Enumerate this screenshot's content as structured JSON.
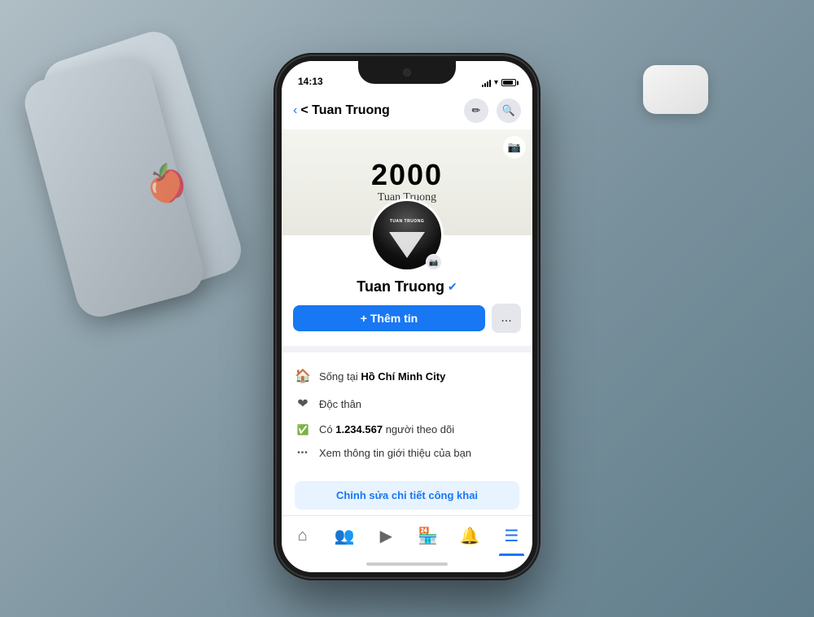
{
  "background": {
    "color": "#8a9ba8"
  },
  "status_bar": {
    "time": "14:13",
    "signal": "all",
    "wifi": "wifi",
    "battery": "battery"
  },
  "nav": {
    "back_label": "< Tuan Truong",
    "edit_icon": "✏",
    "search_icon": "🔍"
  },
  "cover": {
    "year": "2000",
    "signature": "Tuan Truong"
  },
  "profile": {
    "name": "Tuan Truong",
    "verified": true,
    "avatar_text": "TUAN TRUONG"
  },
  "actions": {
    "add_info_label": "+ Thêm tin",
    "more_label": "..."
  },
  "info_items": [
    {
      "icon": "🏠",
      "text": "Sống tại ",
      "highlight": "Hồ Chí Minh City"
    },
    {
      "icon": "❤",
      "text": "Độc thân",
      "highlight": ""
    },
    {
      "icon": "✅",
      "text": "Có ",
      "highlight": "1.234.567",
      "suffix": " người theo dõi"
    },
    {
      "icon": "•••",
      "text": "Xem thông tin giới thiệu của bạn",
      "highlight": ""
    }
  ],
  "edit_public_label": "Chỉnh sửa chi tiết công khai",
  "bottom_nav": {
    "items": [
      {
        "icon": "🏠",
        "label": "home",
        "active": false
      },
      {
        "icon": "👥",
        "label": "friends",
        "active": false
      },
      {
        "icon": "▶",
        "label": "watch",
        "active": false
      },
      {
        "icon": "🏪",
        "label": "marketplace",
        "active": false
      },
      {
        "icon": "🔔",
        "label": "notifications",
        "active": false
      },
      {
        "icon": "☰",
        "label": "menu",
        "active": true
      }
    ]
  }
}
